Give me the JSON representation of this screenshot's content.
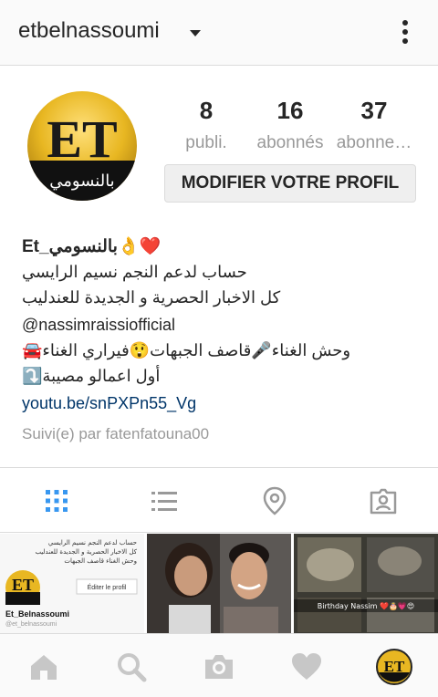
{
  "header": {
    "username": "etbelnassoumi",
    "menu_icon": "kebab-menu-icon"
  },
  "profile": {
    "avatar_logo_text": "ET",
    "avatar_sub_text": "بالنسومي",
    "stats": [
      {
        "value": "8",
        "label": "publi."
      },
      {
        "value": "16",
        "label": "abonnés"
      },
      {
        "value": "37",
        "label": "abonne…"
      }
    ],
    "edit_button_label": "MODIFIER VOTRE PROFIL"
  },
  "bio": {
    "name": "Et_بالنسومي👌❤️",
    "lines": [
      "حساب لدعم النجم نسيم الرايسي",
      "كل الاخبار الحصرية و الجديدة للعندليب",
      "@nassimraissiofficial",
      "وحش الغناء🎤قاصف الجبهات😲فيراري الغناء🚘",
      "أول اعمالو مصيبة⤵️"
    ],
    "website": "youtu.be/snPXPn55_Vg",
    "followed_by": "Suivi(e) par fatenfatouna00"
  },
  "tabs": [
    {
      "name": "grid-view",
      "icon": "grid-icon",
      "active": true
    },
    {
      "name": "list-view",
      "icon": "list-icon",
      "active": false
    },
    {
      "name": "map-view",
      "icon": "location-pin-icon",
      "active": false
    },
    {
      "name": "tagged-view",
      "icon": "tagged-photo-icon",
      "active": false
    }
  ],
  "posts": [
    {
      "type": "profile-screenshot",
      "top_text_1": "حساب لدعم النجم نسيم الرايسي",
      "top_text_2": "كل الاخبار الحصرية و الجديدة للعندليب",
      "top_text_3": "وحش الغناء قاصف الجبهات",
      "button_text": "Éditer le profil",
      "name": "Et_Belnassoumi",
      "handle": "@et_belnassoumi"
    },
    {
      "type": "photo-couple"
    },
    {
      "type": "photo-cake",
      "caption": "Birthday Nassim ❤️🎂💗😍"
    }
  ],
  "bottom_nav": [
    {
      "name": "home",
      "icon": "home-icon"
    },
    {
      "name": "search",
      "icon": "search-icon"
    },
    {
      "name": "camera",
      "icon": "camera-icon"
    },
    {
      "name": "activity",
      "icon": "heart-icon"
    },
    {
      "name": "profile",
      "icon": "profile-avatar-icon"
    }
  ],
  "colors": {
    "accent": "#3897f0",
    "link": "#003569",
    "muted": "#999999",
    "text": "#262626",
    "logo_gold": "#e8b722"
  }
}
